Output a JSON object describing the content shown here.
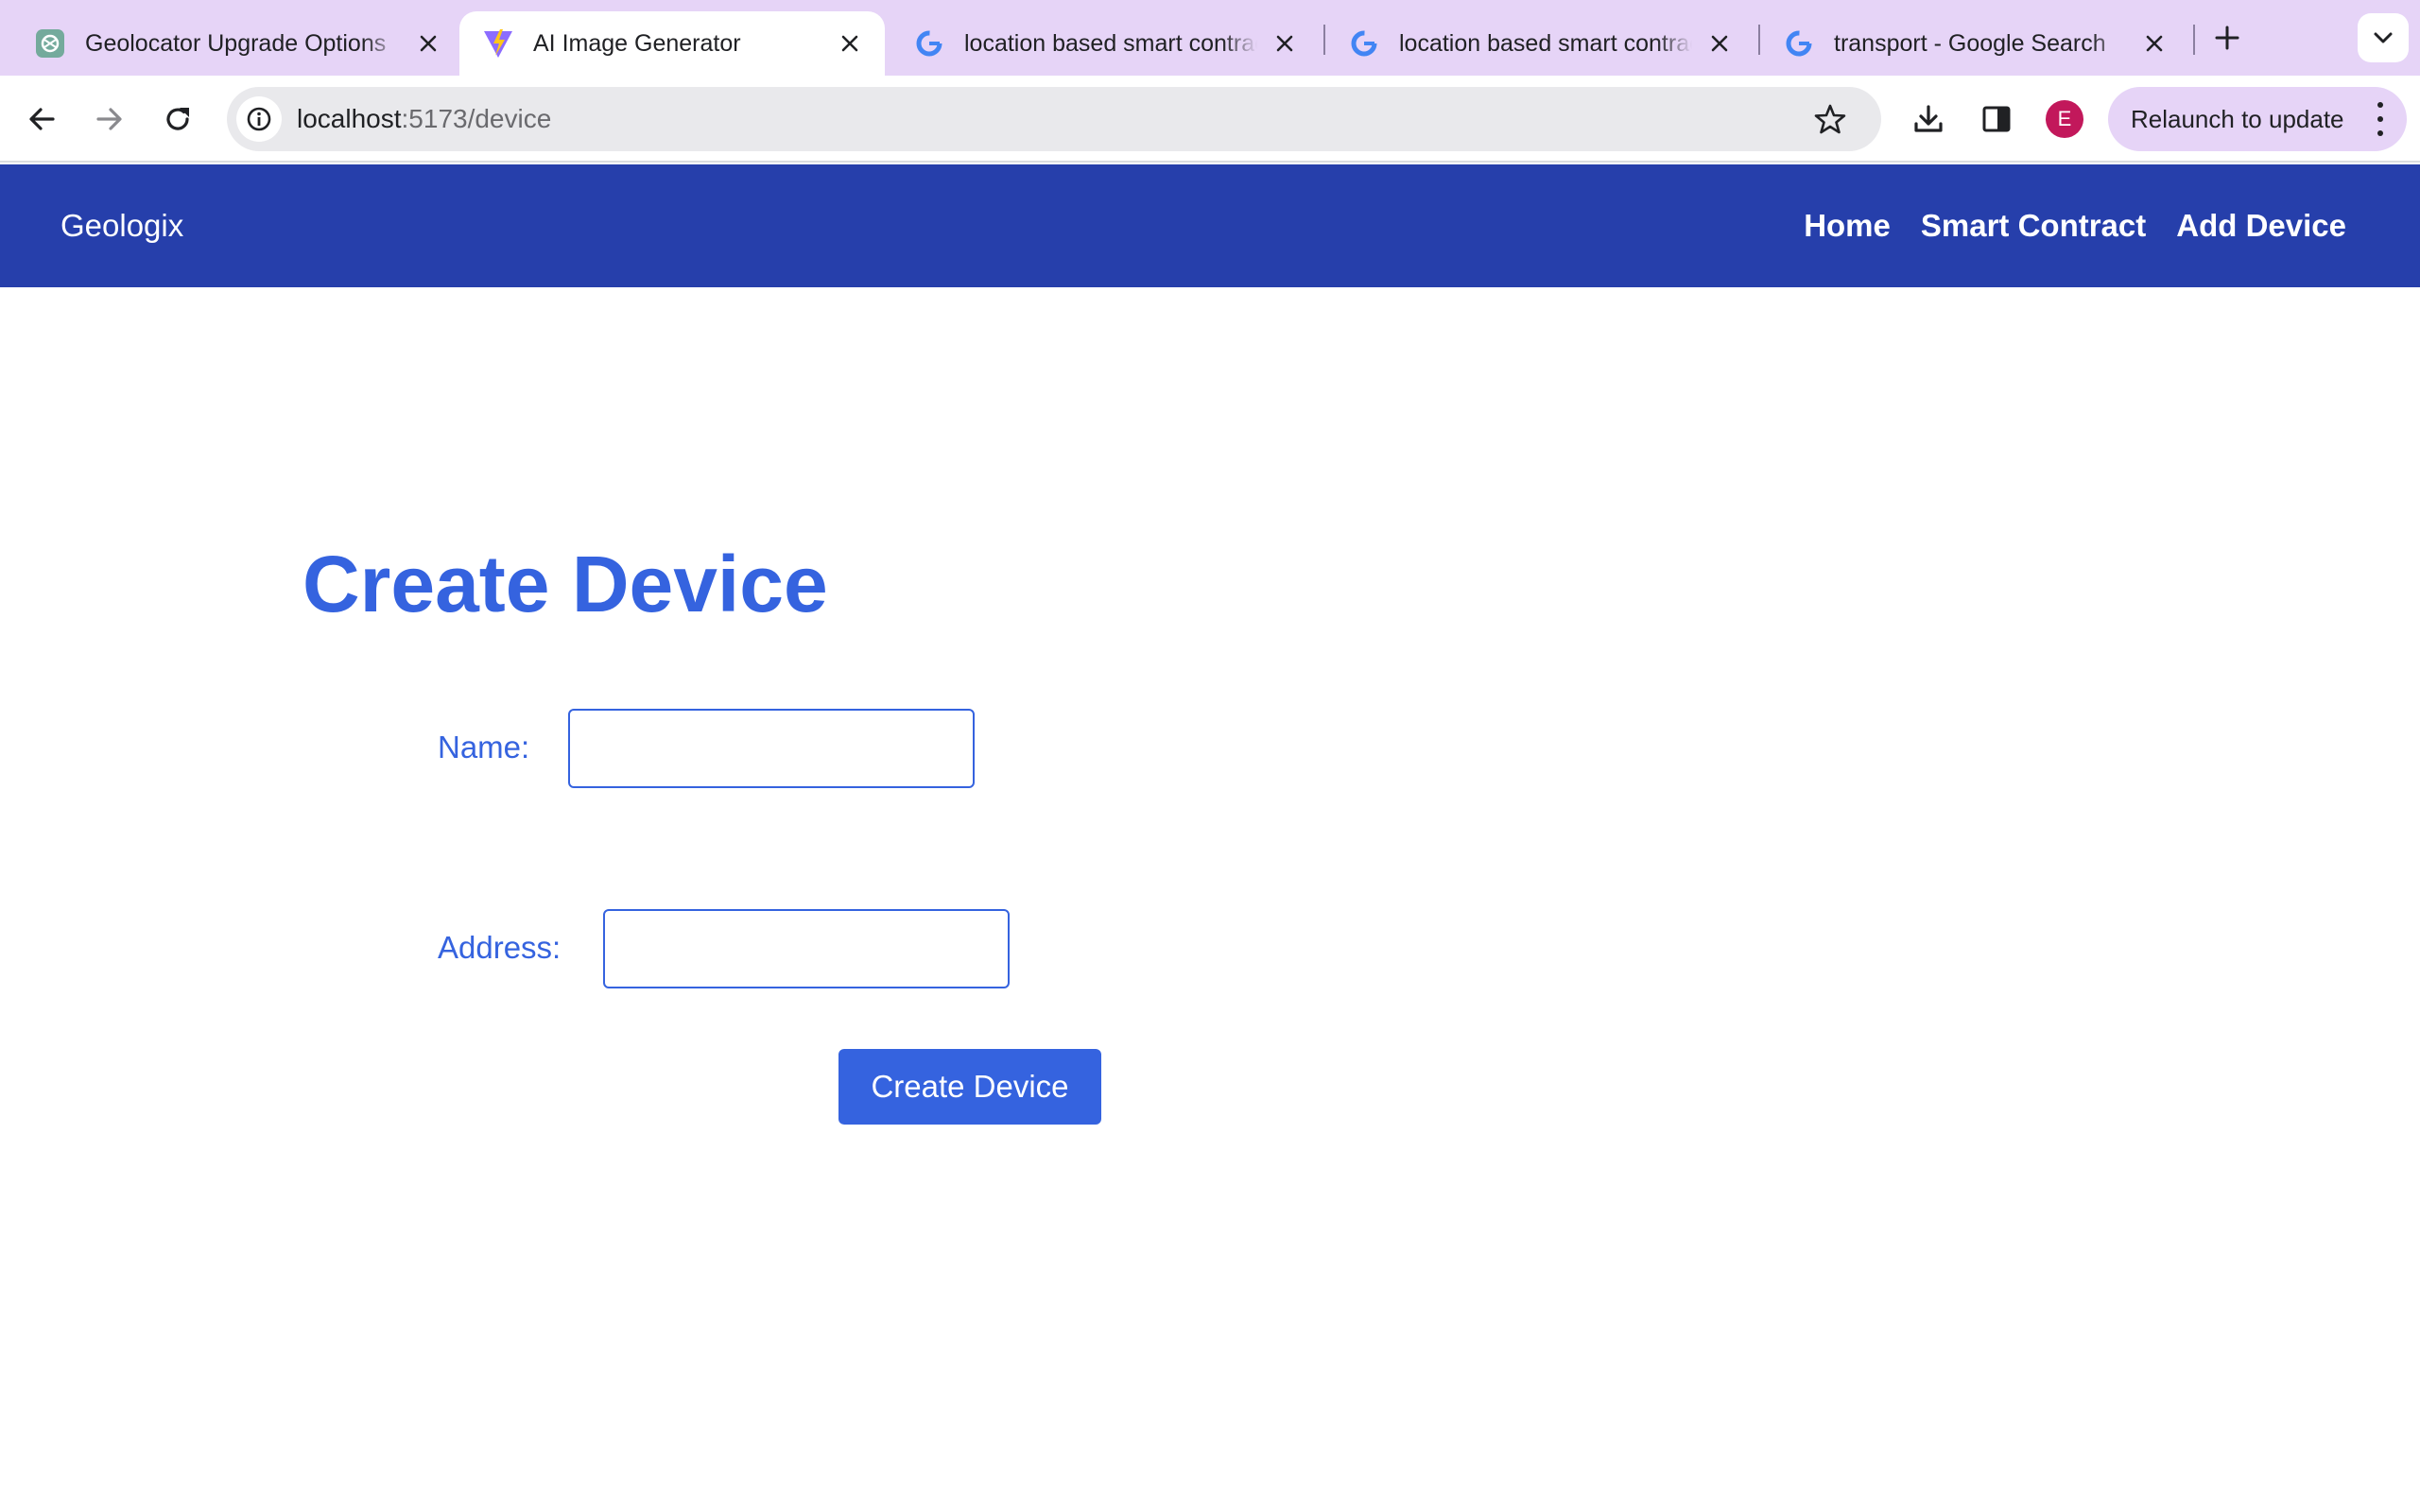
{
  "browser": {
    "tabs": [
      {
        "title": "Geolocator Upgrade Options",
        "favicon": "chatgpt-icon",
        "active": false
      },
      {
        "title": "AI Image Generator",
        "favicon": "vite-icon",
        "active": true
      },
      {
        "title": "location based smart contract",
        "favicon": "google-icon",
        "active": false
      },
      {
        "title": "location based smart contract",
        "favicon": "google-icon",
        "active": false
      },
      {
        "title": "transport - Google Search",
        "favicon": "google-icon",
        "active": false
      }
    ],
    "url_host": "localhost",
    "url_path": ":5173/device",
    "avatar_letter": "E",
    "relaunch_label": "Relaunch to update",
    "colors": {
      "tabstrip": "#e6d4f7",
      "omnibox": "#e9e9ec",
      "avatar": "#c2185b"
    }
  },
  "app": {
    "brand": "Geologix",
    "nav": {
      "home": "Home",
      "smart_contract": "Smart Contract",
      "add_device": "Add Device"
    },
    "colors": {
      "header": "#263fab",
      "accent": "#3563df"
    }
  },
  "form": {
    "title": "Create Device",
    "name_label": "Name:",
    "name_value": "",
    "address_label": "Address:",
    "address_value": "",
    "submit_label": "Create Device"
  }
}
